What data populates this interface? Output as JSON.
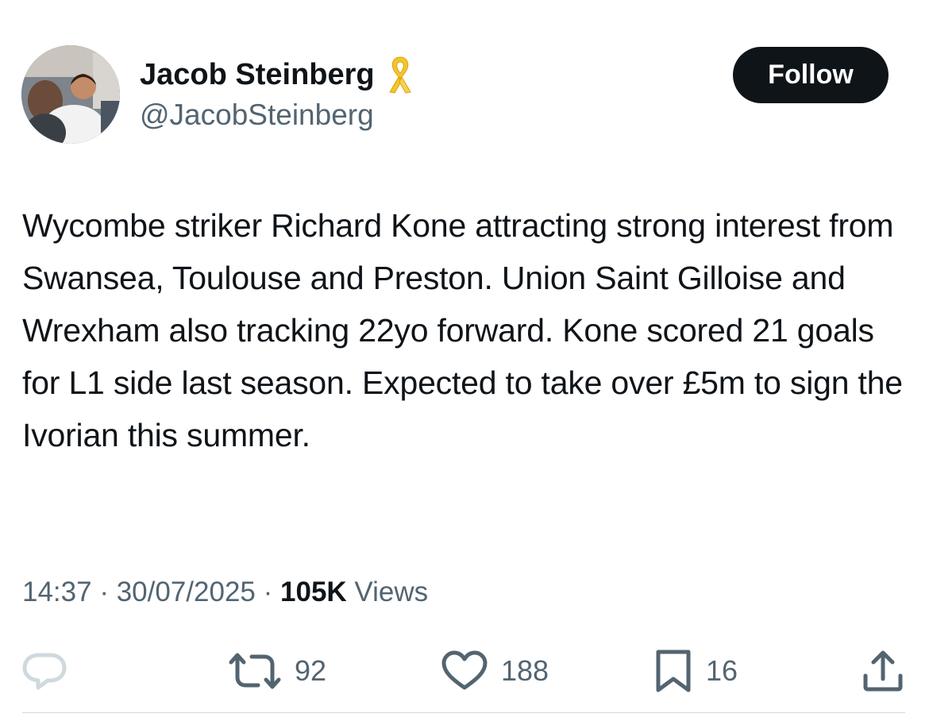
{
  "author": {
    "display_name": "Jacob Steinberg",
    "handle": "@JacobSteinberg",
    "badge_icon": "yellow-ribbon-icon",
    "badge_color": "#f4c430"
  },
  "follow_label": "Follow",
  "tweet": {
    "text": "Wycombe striker Richard Kone attracting strong interest from Swansea, Toulouse and Preston. Union Saint Gilloise and Wrexham also tracking 22yo forward. Kone scored 21 goals for L1 side last season. Expected to take over £5m to sign the Ivorian this summer."
  },
  "meta": {
    "time": "14:37",
    "date": "30/07/2025",
    "separator": "·",
    "views_count": "105K",
    "views_label": "Views"
  },
  "actions": {
    "reply": {
      "icon": "reply-icon",
      "count": ""
    },
    "retweet": {
      "icon": "retweet-icon",
      "count": "92"
    },
    "like": {
      "icon": "heart-icon",
      "count": "188"
    },
    "bookmark": {
      "icon": "bookmark-icon",
      "count": "16"
    },
    "share": {
      "icon": "share-icon"
    }
  },
  "colors": {
    "text": "#0f1419",
    "secondary": "#536471",
    "follow_bg": "#0f1419",
    "follow_text": "#ffffff",
    "reply_icon": "#cfd9de",
    "divider": "#cfd9de"
  }
}
